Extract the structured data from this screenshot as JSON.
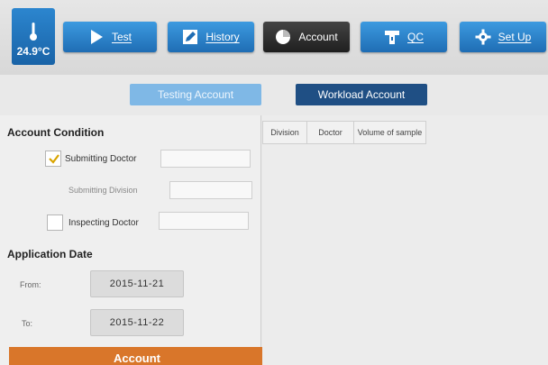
{
  "temperature": {
    "value": "24.9°C",
    "icon": "thermometer-icon"
  },
  "nav": [
    {
      "label": "Test",
      "icon": "play-icon"
    },
    {
      "label": "History",
      "icon": "edit-icon"
    },
    {
      "label": "Account",
      "icon": "chart-icon",
      "active": true
    },
    {
      "label": "QC",
      "icon": "qc-icon"
    },
    {
      "label": "Set Up",
      "icon": "gear-icon"
    }
  ],
  "subtabs": {
    "testing": "Testing Account",
    "workload": "Workload Account"
  },
  "condition": {
    "title": "Account Condition",
    "submitting_doctor": {
      "label": "Submitting Doctor",
      "checked": true,
      "value": ""
    },
    "submitting_division": {
      "label": "Submitting Division",
      "value": ""
    },
    "inspecting_doctor": {
      "label": "Inspecting Doctor",
      "checked": false,
      "value": ""
    }
  },
  "application_date": {
    "title": "Application Date",
    "from_label": "From:",
    "from_value": "2015-11-21",
    "to_label": "To:",
    "to_value": "2015-11-22"
  },
  "query_button": "Account",
  "table": {
    "columns": [
      "Division",
      "Doctor",
      "Volume of sample"
    ]
  },
  "colors": {
    "nav_blue": "#2a80c8",
    "active_dark": "#2a2a2a",
    "workload_tab": "#1f4f84",
    "query_orange": "#d9762a"
  }
}
